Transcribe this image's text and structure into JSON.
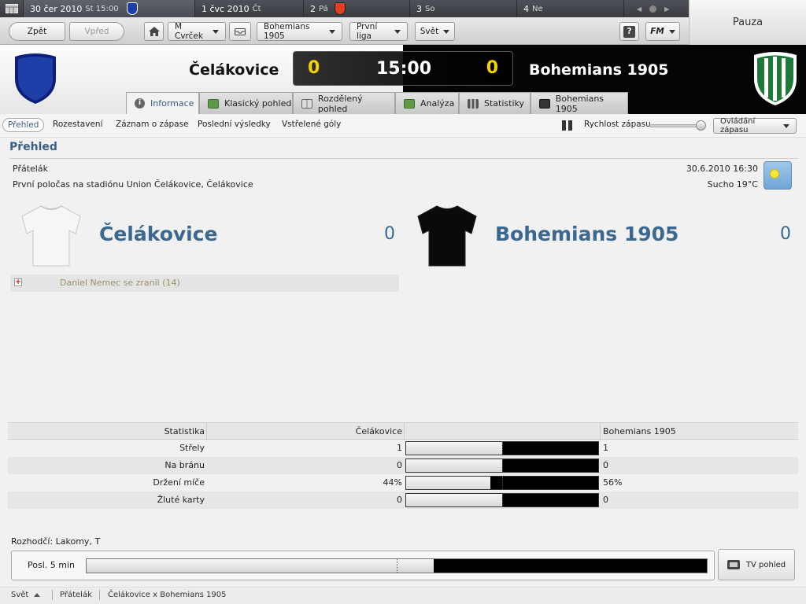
{
  "calendar": {
    "days": [
      {
        "date": "30 čer 2010",
        "weekday": "St 15:00"
      },
      {
        "date": "1 čvc 2010",
        "weekday": "Čt"
      },
      {
        "date": "2",
        "weekday": "Pá"
      },
      {
        "date": "3",
        "weekday": "So"
      },
      {
        "date": "4",
        "weekday": "Ne"
      }
    ],
    "pause_label": "Pauza"
  },
  "toolbar": {
    "back_label": "Zpět",
    "forward_label": "Vpřed",
    "manager_label": "M Cvrček",
    "club_label": "Bohemians 1905",
    "league_label": "První liga",
    "world_label": "Svět",
    "help_label": "?",
    "fm_label": "FM"
  },
  "match": {
    "home_team": "Čelákovice",
    "away_team": "Bohemians 1905",
    "home_score": "0",
    "away_score": "0",
    "clock": "15:00",
    "home_color": "#1e3fa8",
    "away_color": "#1f7a3a"
  },
  "tabs": [
    {
      "label": "Informace"
    },
    {
      "label": "Klasický pohled"
    },
    {
      "label": "Rozdělený pohled"
    },
    {
      "label": "Analýza"
    },
    {
      "label": "Statistiky"
    },
    {
      "label": "Bohemians 1905"
    }
  ],
  "subnav": {
    "items": [
      "Přehled",
      "Rozestavení",
      "Záznam o zápase",
      "Poslední výsledky",
      "Vstřelené góly"
    ],
    "speed_label": "Rychlost zápasu",
    "control_label": "Ovládání zápasu"
  },
  "overview": {
    "title": "Přehled",
    "competition": "Přátelák",
    "venue": "První poločas na stadiónu Union Čelákovice, Čelákovice",
    "datetime": "30.6.2010 16:30",
    "weather": "Sucho 19°C",
    "home_team": "Čelákovice",
    "home_score": "0",
    "away_team": "Bohemians 1905",
    "away_score": "0",
    "event": "Daniel Nemec se zranil (14)"
  },
  "stats": {
    "header_label": "Statistika",
    "home_team": "Čelákovice",
    "away_team": "Bohemians 1905",
    "rows": [
      {
        "label": "Střely",
        "home": "1",
        "away": "1",
        "home_share": 0.5
      },
      {
        "label": "Na bránu",
        "home": "0",
        "away": "0",
        "home_share": 0.5
      },
      {
        "label": "Držení míče",
        "home": "44%",
        "away": "56%",
        "home_share": 0.44
      },
      {
        "label": "Žluté karty",
        "home": "0",
        "away": "0",
        "home_share": 0.5
      }
    ]
  },
  "referee": "Rozhodčí: Lakomy, T",
  "momentum": {
    "label": "Posl. 5 min",
    "home_share": 0.56
  },
  "tv_label": "TV pohled",
  "footer": {
    "items": [
      "Svět",
      "Přátelák",
      "Čelákovice x Bohemians 1905"
    ]
  }
}
